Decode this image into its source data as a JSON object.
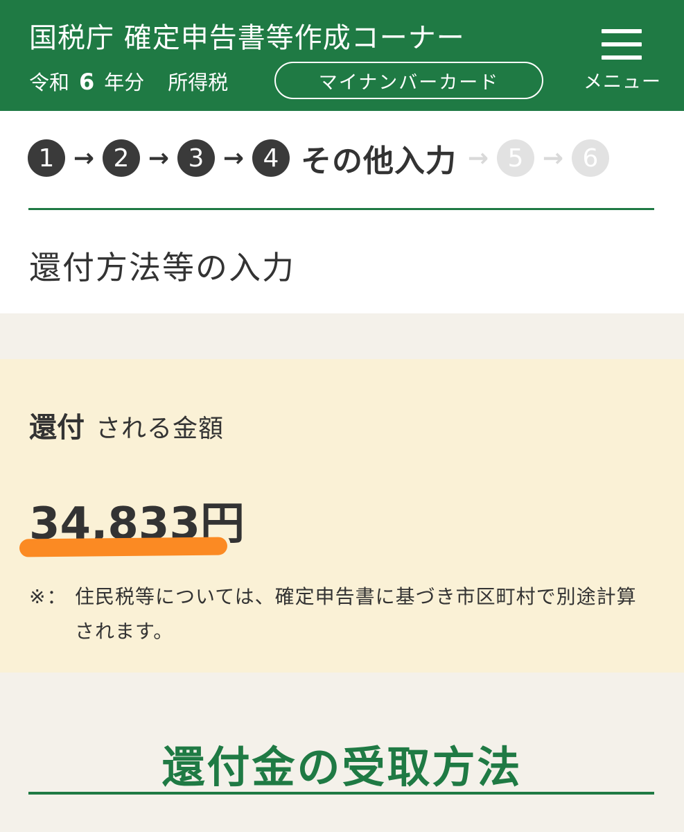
{
  "header": {
    "site_title": "国税庁 確定申告書等作成コーナー",
    "era": "令和",
    "year_number": "6",
    "year_suffix": "年分",
    "tax_type": "所得税",
    "mynumber_button": "マイナンバーカード",
    "menu_label": "メニュー"
  },
  "steps": {
    "items": [
      "1",
      "2",
      "3",
      "4",
      "5",
      "6"
    ],
    "current_index": 4,
    "current_label": "その他入力",
    "arrow": "→"
  },
  "page_title": "還付方法等の入力",
  "refund": {
    "heading_strong": "還付",
    "heading_rest": "される金額",
    "amount": "34,833円",
    "note_mark": "※：",
    "note_text": "住民税等については、確定申告書に基づき市区町村で別途計算されます。"
  },
  "receive_section": {
    "title": "還付金の受取方法"
  },
  "colors": {
    "header_green": "#1f7a44",
    "refund_box_bg": "#faf1d6",
    "highlight_orange": "#fb8a23",
    "page_bg": "#f4f1ea"
  }
}
